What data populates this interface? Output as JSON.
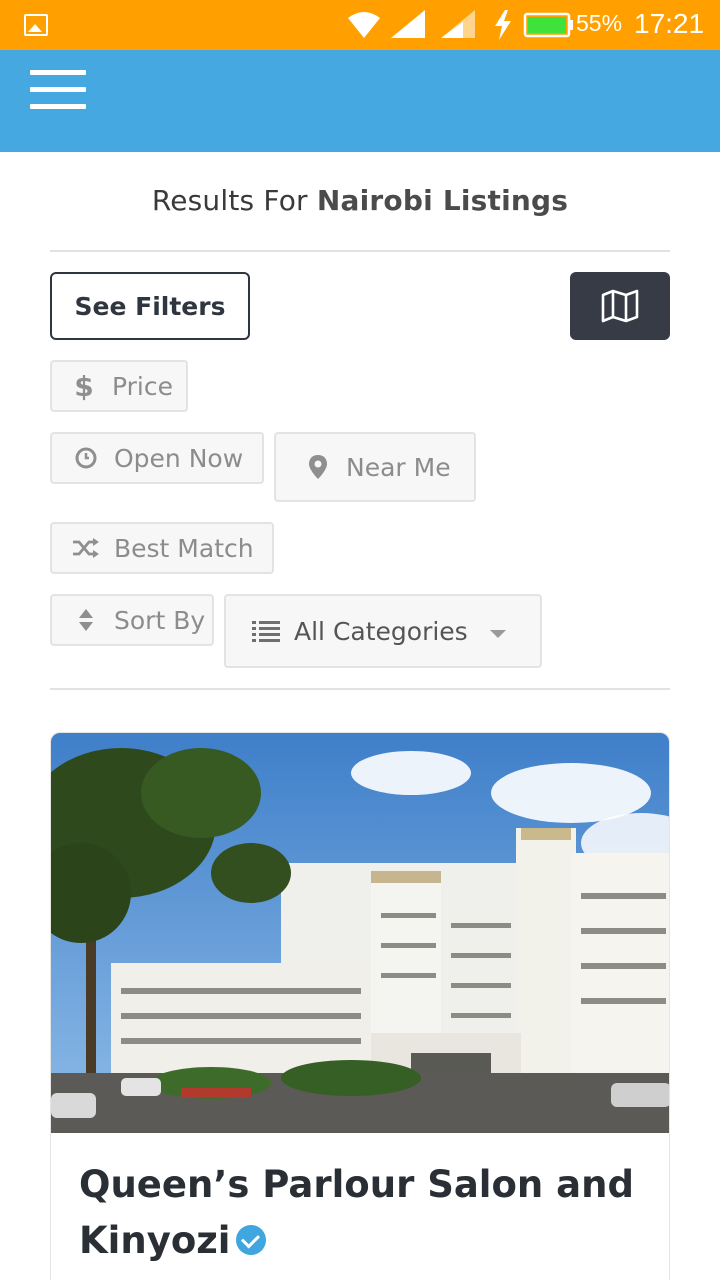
{
  "status_bar": {
    "battery_percent": "55%",
    "time": "17:21",
    "icons": [
      "gallery-icon",
      "wifi-icon",
      "signal-icon",
      "signal-icon",
      "charging-icon",
      "battery-icon"
    ]
  },
  "app_bar": {
    "color": "#45a8e0",
    "menu_icon": "hamburger-menu-icon"
  },
  "results": {
    "prefix": "Results For ",
    "city": "Nairobi Listings"
  },
  "toolbar": {
    "see_filters_label": "See Filters",
    "map_icon": "map-icon"
  },
  "filters": {
    "price": "Price",
    "open_now": "Open Now",
    "near_me": "Near Me",
    "best_match": "Best Match",
    "sort_by": "Sort By",
    "category": "All Categories"
  },
  "listing": {
    "title": "Queen’s Parlour Salon and Kinyozi",
    "verified": true,
    "image_description": "hotel building"
  },
  "colors": {
    "status_bar": "#ff9f00",
    "app_bar": "#45a8e0",
    "dark_button": "#363b45",
    "verified_badge": "#3fa6df"
  }
}
